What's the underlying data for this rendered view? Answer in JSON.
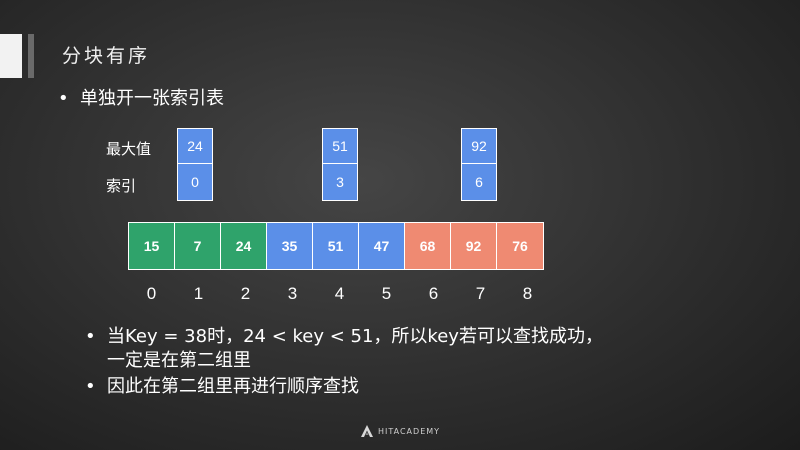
{
  "title": "分块有序",
  "bullet1": "单独开一张索引表",
  "index_table": {
    "label_max": "最大值",
    "label_index": "索引",
    "blocks": [
      {
        "max": "24",
        "index": "0"
      },
      {
        "max": "51",
        "index": "3"
      },
      {
        "max": "92",
        "index": "6"
      }
    ]
  },
  "array": {
    "values": [
      "15",
      "7",
      "24",
      "35",
      "51",
      "47",
      "68",
      "92",
      "76"
    ],
    "positions": [
      "0",
      "1",
      "2",
      "3",
      "4",
      "5",
      "6",
      "7",
      "8"
    ],
    "colors": {
      "group1": "#2fa36b",
      "group2": "#5b8fe8",
      "group3": "#ef8a72"
    }
  },
  "bullet2_line1": "当Key = 38时，24 < key < 51，所以key若可以查找成功，",
  "bullet2_line2": "一定是在第二组里",
  "bullet3": "因此在第二组里再进行顺序查找",
  "footer": {
    "logo_text": "HITACADEMY",
    "logo_icon": "hit-academy-logo-icon"
  }
}
